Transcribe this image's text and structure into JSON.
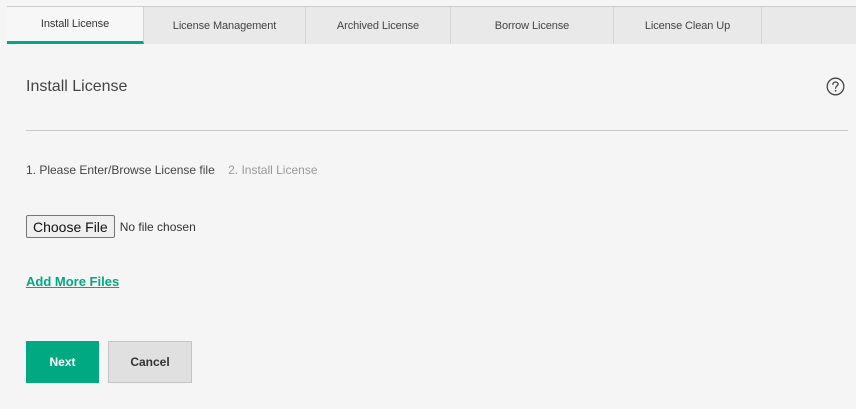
{
  "tabs": [
    {
      "label": "Install License",
      "active": true
    },
    {
      "label": "License Management",
      "active": false
    },
    {
      "label": "Archived License",
      "active": false
    },
    {
      "label": "Borrow License",
      "active": false
    },
    {
      "label": "License Clean Up",
      "active": false
    },
    {
      "label": "",
      "active": false
    }
  ],
  "page": {
    "title": "Install License",
    "help_icon": "help-circle-icon"
  },
  "steps": {
    "step1": "1. Please Enter/Browse License file",
    "step2": "2. Install License"
  },
  "file_input": {
    "button_label": "Choose File",
    "status": "No file chosen"
  },
  "add_more": "Add More Files",
  "actions": {
    "next_label": "Next",
    "cancel_label": "Cancel"
  },
  "colors": {
    "accent": "#01a982",
    "background": "#f5f5f5",
    "inactive_text": "#999999"
  }
}
